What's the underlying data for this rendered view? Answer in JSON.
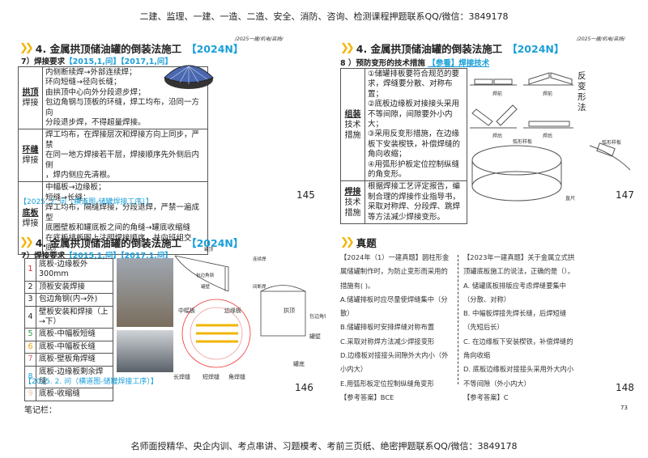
{
  "header": "二建、监理、一建、一造、二造、安全、消防、咨询、检测课程押题联系QQ/微信：3849178",
  "footer": "名师面授精华、央企内训、考点串讲、习题模考、考前三页纸、绝密押题联系QQ/微信：3849178",
  "notes_label": "笔记栏：",
  "page_number": "73",
  "slides": [
    {
      "crumb": "/2025一建/机电/高扬/",
      "title": "4. 金属拱顶储油罐的倒装法施工",
      "tag": "【2024N】",
      "sub": "7）焊接要求",
      "refs": "【2015,1,问】【2017,1,问】",
      "rows": [
        {
          "label": [
            "拱顶",
            "焊接"
          ],
          "lines": [
            "内侧断续焊→外部连续焊；",
            "环向短缝→径向长缝；",
            "由拱顶中心向外分段退步焊；",
            "包边角钢与顶板的环缝，焊工均布，沿同一方向",
            "分段退步焊，不得超量焊接。"
          ]
        },
        {
          "label": [
            "环缝",
            "焊接"
          ],
          "lines": [
            "焊工均布，在焊接层次和焊接方向上同步，严禁",
            "在同一地方焊接若干层，焊接顺序先外侧后内侧",
            "，焊内侧应先清根。"
          ]
        },
        {
          "label": [
            "底板",
            "焊接"
          ],
          "lines": [
            "中幅板→边缘板；",
            "短缝→长缝；",
            "焊工均布，隔缝焊接，分段退焊，严禁一遍成型",
            "底圈壁板和罐底板之间的角缝→罐底收缩缝",
            "在底板排板图上注明焊接顺序，并向班组交底。"
          ]
        }
      ],
      "note": "【2025. 2. 问（横道图-储罐焊接工序）】",
      "page": "145"
    },
    {
      "crumb": "/2025一建/机电/高扬/",
      "title": "4. 金属拱顶储油罐的倒装法施工",
      "tag": "【2024N】",
      "sub": "8 ）预防变形的技术措施",
      "refs": "【参看】焊接技术",
      "rows": [
        {
          "label": [
            "组装",
            "技术",
            "措施"
          ],
          "lines": [
            "①储罐排板要符合规范的要",
            "求，焊缝要分散、对称布置；",
            "②底板边缘板对接接头采用",
            "不等间隙，间隙要外小内大；",
            "③采用反变形措施，在边缘",
            "板下安装楔铁，补偿焊缝的",
            "角向收缩；",
            "④用弧形护板定位控制纵缝",
            "的角变形。"
          ]
        },
        {
          "label": [
            "焊接",
            "技术",
            "措施"
          ],
          "lines": [
            "根据焊接工艺评定报告，编",
            "制合理的焊接作业指导书，",
            "采取对称焊、分段焊、跳焊",
            "等方法减少焊接变形。"
          ]
        }
      ],
      "diagram": {
        "before": "焊前",
        "after": "焊后",
        "method": "反变形法",
        "arc": "弧形样板",
        "ruler": "直尺"
      },
      "page": "147"
    },
    {
      "crumb": "/2025一建/机电/高扬/",
      "title": "4. 金属拱顶储油罐的倒装法施工",
      "tag": "【2024N】",
      "sub": "7）焊接要求",
      "refs": "【2015,1,问】【2017,1,问】",
      "steps": [
        {
          "n": "1",
          "t": "底板-边缘板外300mm",
          "c": "#e02020"
        },
        {
          "n": "2",
          "t": "顶板安装焊接",
          "c": "#222222"
        },
        {
          "n": "3",
          "t": "包边角钢(内→外)",
          "c": "#222222"
        },
        {
          "n": "4",
          "t": "壁板安装和焊接（上→下）",
          "c": "#222222"
        },
        {
          "n": "5",
          "t": "底板-中幅板短缝",
          "c": "#2a9a3a"
        },
        {
          "n": "6",
          "t": "底板-中幅板长缝",
          "c": "#f0a000"
        },
        {
          "n": "7",
          "t": "底板-壁板角焊缝",
          "c": "#e06070"
        },
        {
          "n": "8",
          "t": "底板-边缘板剩余焊缝",
          "c": "#1a9fd9"
        },
        {
          "n": "9",
          "t": "底板-收缩缝",
          "c": "#f0c8a0"
        }
      ],
      "diagram": {
        "roof": "罐顶",
        "cont": "连续焊",
        "angle": "包边角钢",
        "wall": "罐壁",
        "inter": "间断焊",
        "mid": "中幅板",
        "edge": "边缘板",
        "long": "长焊缝",
        "short": "短焊缝",
        "corner": "角焊缝",
        "arch": "拱顶",
        "wrap": "包边角钢",
        "tankwall": "罐壁",
        "bottom": "罐底"
      },
      "note": "【2025. 2. 问（横道图-储罐焊接工序）】",
      "page": "146"
    },
    {
      "title": "真题",
      "q1": [
        "【2024年（1）一建真题】圆柱形金",
        "属储罐制作时，为防止变形而采用的",
        "措施有(     )。",
        "A.储罐排板时应尽量使焊缝集中（分",
        "散）",
        "B.储罐排板时安排焊缝对称布置",
        "C.采取对称焊方法减少焊接变形",
        "D.边缘板对接接头间隙外大内小（外",
        "小内大）",
        "E.用弧形板定位控制纵缝角变形",
        "【参考答案】BCE"
      ],
      "q2": [
        "【2023年一建真题】关于金属立式拱",
        "顶罐底板施工的说法，正确的是（）。",
        "A. 储罐底板排版应考虑焊缝要集中",
        "（分散、对称）",
        "B. 中幅板焊接先焊长缝，后焊短缝",
        "（先短后长）",
        "C. 在边缘板下安装楔铁，补偿焊缝的",
        "角向收缩",
        "D. 底板边缘板对接接头采用外大内小",
        "不等间隙（外小内大）",
        "【参考答案】C"
      ],
      "page": "148"
    }
  ]
}
